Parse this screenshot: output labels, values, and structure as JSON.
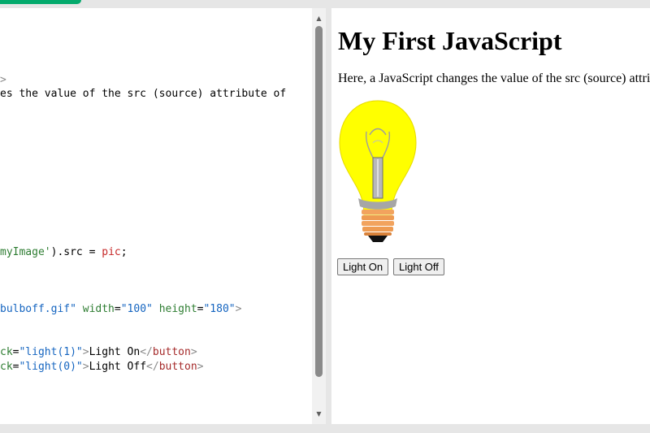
{
  "editor": {
    "lines": [
      {
        "parts": [
          {
            "t": ">",
            "c": "bracket"
          }
        ]
      },
      {
        "parts": [
          {
            "t": "es the value of the src (source) attribute of",
            "c": "text"
          }
        ]
      },
      {
        "parts": [
          {
            "t": "myImage'",
            "c": "str"
          },
          {
            "t": ").src = ",
            "c": "text"
          },
          {
            "t": "pic",
            "c": "var"
          },
          {
            "t": ";",
            "c": "text"
          }
        ]
      },
      {
        "parts": [
          {
            "t": "bulboff.gif\"",
            "c": "val"
          },
          {
            "t": " ",
            "c": "text"
          },
          {
            "t": "width",
            "c": "attr"
          },
          {
            "t": "=",
            "c": "text"
          },
          {
            "t": "\"100\"",
            "c": "val"
          },
          {
            "t": " ",
            "c": "text"
          },
          {
            "t": "height",
            "c": "attr"
          },
          {
            "t": "=",
            "c": "text"
          },
          {
            "t": "\"180\"",
            "c": "val"
          },
          {
            "t": ">",
            "c": "bracket"
          }
        ]
      },
      {
        "parts": [
          {
            "t": "ck",
            "c": "attr"
          },
          {
            "t": "=",
            "c": "text"
          },
          {
            "t": "\"light(1)\"",
            "c": "val"
          },
          {
            "t": ">",
            "c": "bracket"
          },
          {
            "t": "Light On",
            "c": "text"
          },
          {
            "t": "</",
            "c": "bracket"
          },
          {
            "t": "button",
            "c": "tag"
          },
          {
            "t": ">",
            "c": "bracket"
          }
        ]
      },
      {
        "parts": [
          {
            "t": "ck",
            "c": "attr"
          },
          {
            "t": "=",
            "c": "text"
          },
          {
            "t": "\"light(0)\"",
            "c": "val"
          },
          {
            "t": ">",
            "c": "bracket"
          },
          {
            "t": "Light Off",
            "c": "text"
          },
          {
            "t": "</",
            "c": "bracket"
          },
          {
            "t": "button",
            "c": "tag"
          },
          {
            "t": ">",
            "c": "bracket"
          }
        ]
      }
    ]
  },
  "result": {
    "heading": "My First JavaScript",
    "description": "Here, a JavaScript changes the value of the src (source) attribu",
    "bulb_state": "on",
    "buttons": {
      "on_label": "Light On",
      "off_label": "Light Off"
    }
  },
  "icons": {
    "scroll_up": "scroll-up-arrow-icon",
    "scroll_down": "scroll-down-arrow-icon",
    "bulb": "lightbulb-icon"
  },
  "colors": {
    "run_button": "#04aa6d",
    "bulb_yellow": "#ffff00",
    "tag": "#a52a2a",
    "attr": "#2e7d32",
    "value": "#1565c0",
    "variable": "#c62828"
  }
}
